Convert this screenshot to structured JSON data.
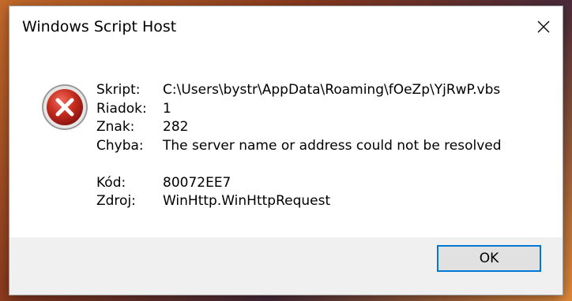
{
  "window": {
    "title": "Windows Script Host"
  },
  "icons": {
    "dialog": "error-icon",
    "close": "close-icon"
  },
  "details": {
    "script_label": "Skript:",
    "script_value": "C:\\Users\\bystr\\AppData\\Roaming\\fOeZp\\YjRwP.vbs",
    "line_label": "Riadok:",
    "line_value": "1",
    "char_label": "Znak:",
    "char_value": "282",
    "error_label": "Chyba:",
    "error_value": "The server name or address could not be resolved",
    "code_label": "Kód:",
    "code_value": "80072EE7",
    "source_label": "Zdroj:",
    "source_value": "WinHttp.WinHttpRequest"
  },
  "buttons": {
    "ok_label": "OK"
  },
  "colors": {
    "error_red": "#c42b1c",
    "accent": "#0078d7"
  }
}
